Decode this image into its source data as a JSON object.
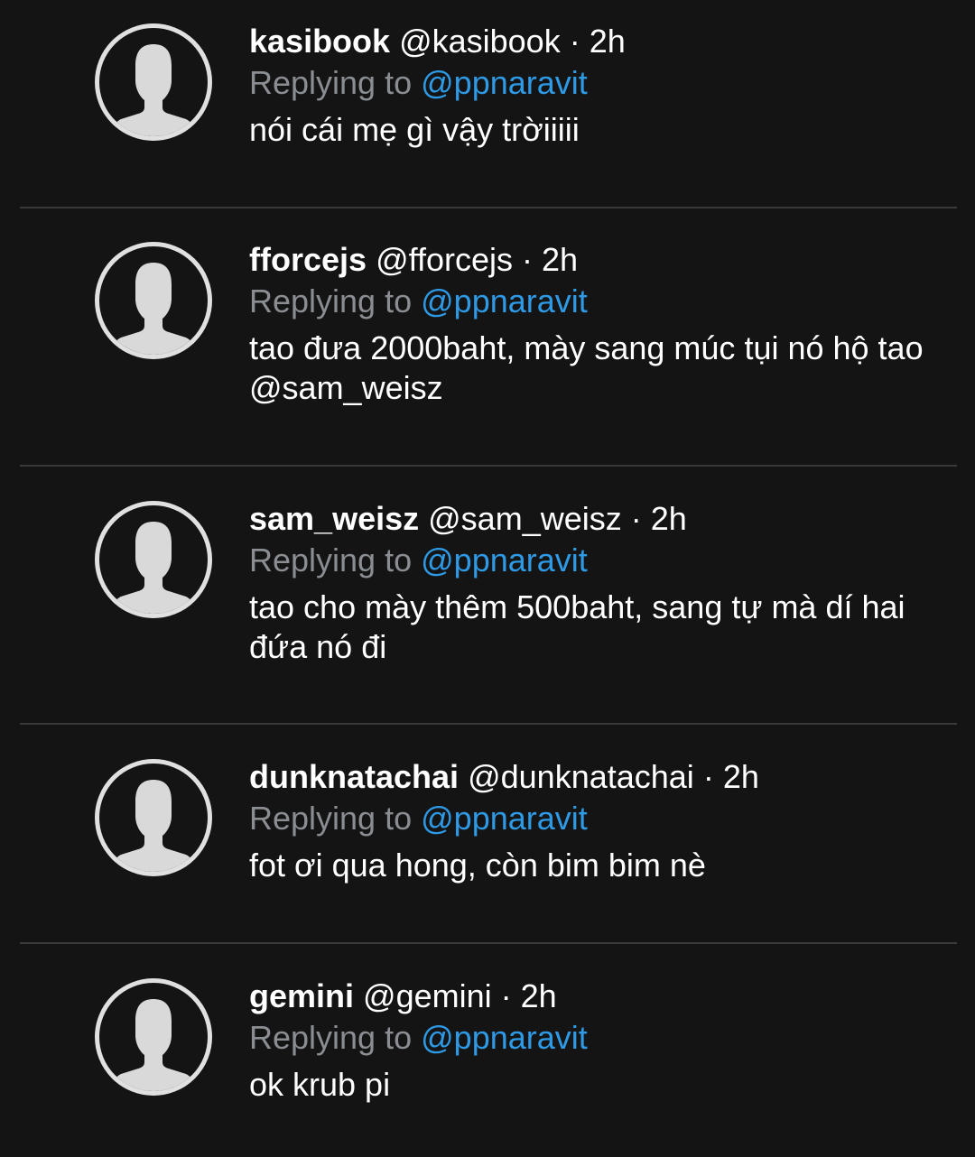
{
  "replies": [
    {
      "display_name": "kasibook",
      "handle": "@kasibook",
      "time": "2h",
      "replying_label": "Replying to",
      "replying_to": "@ppnaravit",
      "text": "nói cái mẹ gì vậy trờiiiii"
    },
    {
      "display_name": "fforcejs",
      "handle": "@fforcejs",
      "time": "2h",
      "replying_label": "Replying to",
      "replying_to": "@ppnaravit",
      "text": "tao đưa 2000baht, mày sang múc tụi nó hộ tao @sam_weisz"
    },
    {
      "display_name": "sam_weisz",
      "handle": "@sam_weisz",
      "time": "2h",
      "replying_label": "Replying to",
      "replying_to": "@ppnaravit",
      "text": "tao cho mày thêm 500baht, sang tự mà dí hai đứa nó đi"
    },
    {
      "display_name": "dunknatachai",
      "handle": "@dunknatachai",
      "time": "2h",
      "replying_label": "Replying to",
      "replying_to": "@ppnaravit",
      "text": "fot ơi qua hong, còn bim bim nè"
    },
    {
      "display_name": "gemini",
      "handle": "@gemini",
      "time": "2h",
      "replying_label": "Replying to",
      "replying_to": "@ppnaravit",
      "text": "ok krub pi"
    }
  ],
  "separator": "·",
  "avatar_icon": "default-person-silhouette-icon",
  "colors": {
    "background": "#141414",
    "text": "#ffffff",
    "muted": "#8a8d91",
    "mention": "#2e9ae6",
    "divider": "#3a3a3a",
    "avatar": "#d9d9d9"
  }
}
